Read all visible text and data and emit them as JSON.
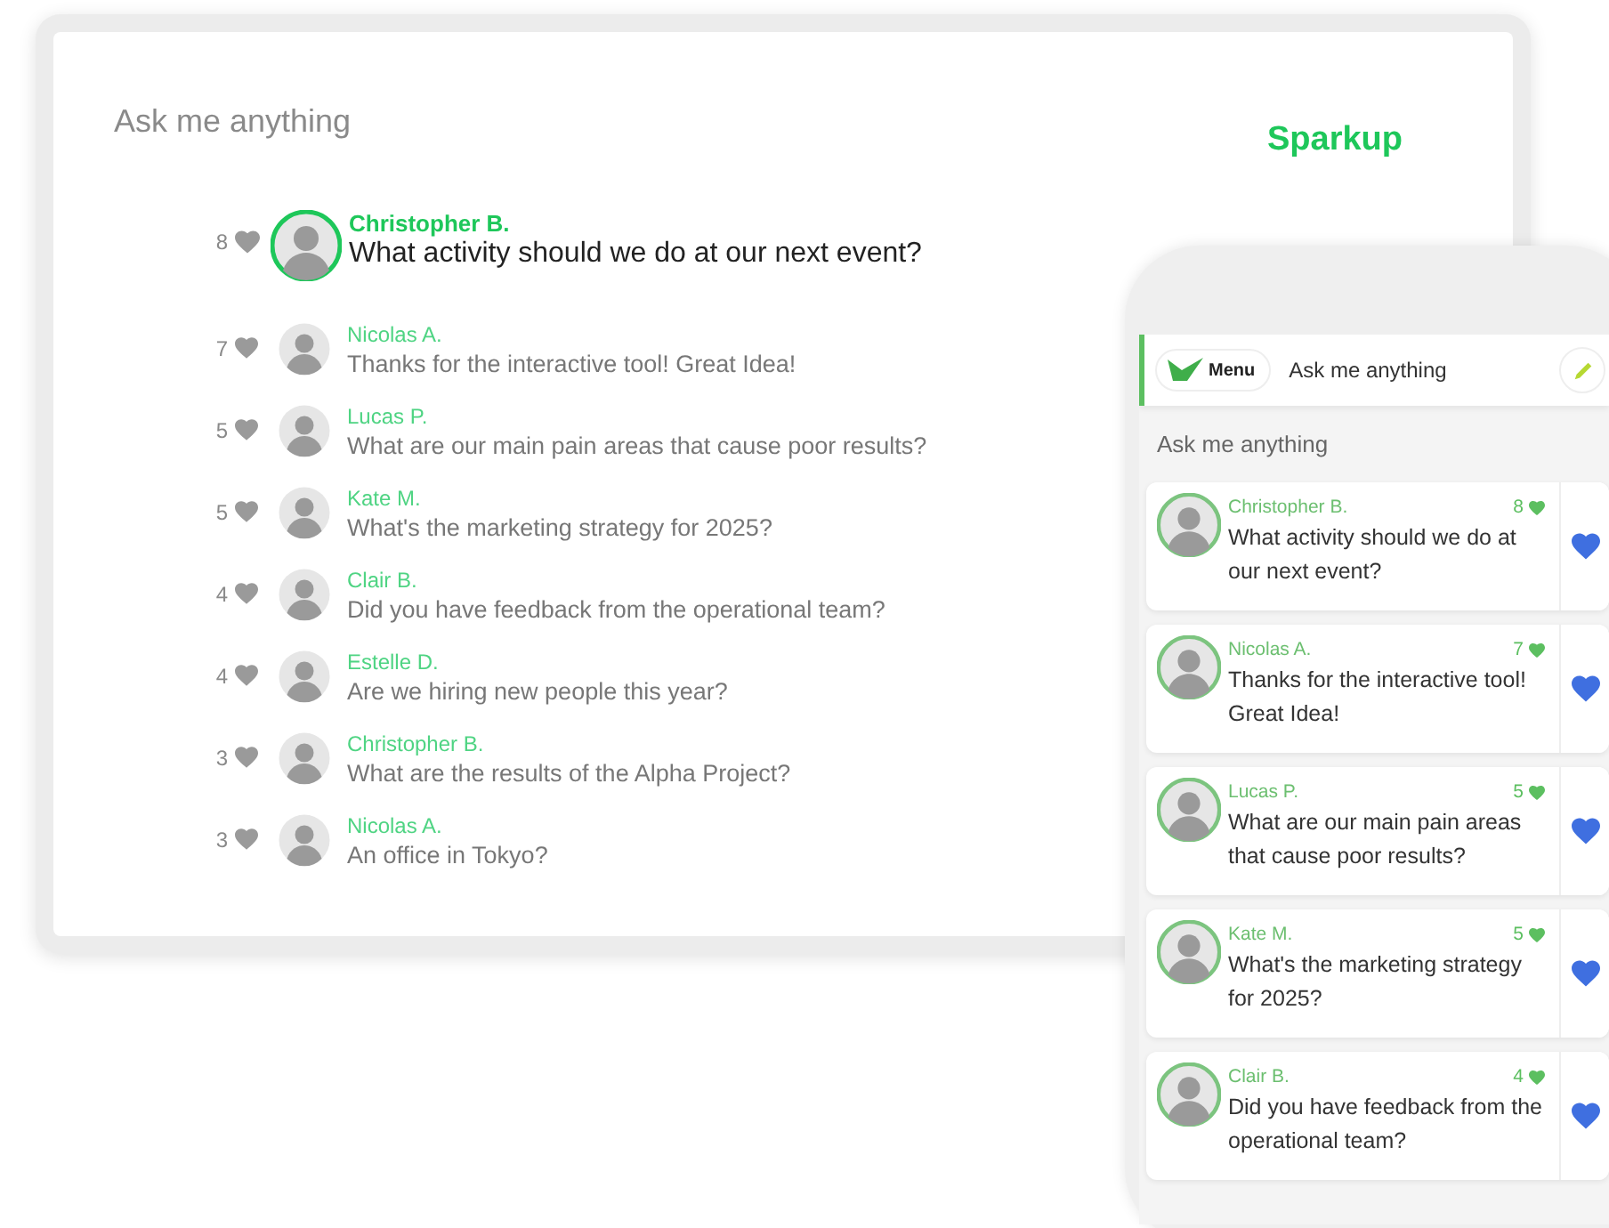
{
  "desktop": {
    "title": "Ask me anything",
    "logo": "Sparkup",
    "questions": [
      {
        "author": "Christopher B.",
        "question": "What activity should we do at our next event?",
        "votes": "8",
        "featured": true
      },
      {
        "author": "Nicolas A.",
        "question": "Thanks for the interactive tool! Great Idea!",
        "votes": "7",
        "featured": false
      },
      {
        "author": "Lucas P.",
        "question": "What are our main pain areas that cause poor results?",
        "votes": "5",
        "featured": false
      },
      {
        "author": "Kate M.",
        "question": "What's the marketing strategy for 2025?",
        "votes": "5",
        "featured": false
      },
      {
        "author": "Clair B.",
        "question": "Did you have feedback from the operational team?",
        "votes": "4",
        "featured": false
      },
      {
        "author": "Estelle D.",
        "question": "Are we hiring new people this year?",
        "votes": "4",
        "featured": false
      },
      {
        "author": "Christopher B.",
        "question": "What are the results of the Alpha Project?",
        "votes": "3",
        "featured": false
      },
      {
        "author": "Nicolas A.",
        "question": "An office in Tokyo?",
        "votes": "3",
        "featured": false
      }
    ]
  },
  "phone": {
    "menu_label": "Menu",
    "header_title": "Ask me anything",
    "section_title": "Ask me anything",
    "questions": [
      {
        "author": "Christopher B.",
        "votes": "8",
        "question": "What activity should we do at our next event?",
        "liked": true
      },
      {
        "author": "Nicolas A.",
        "votes": "7",
        "question": "Thanks for the interactive tool! Great Idea!",
        "liked": true
      },
      {
        "author": "Lucas P.",
        "votes": "5",
        "question": "What are our main pain areas that cause poor results?",
        "liked": true
      },
      {
        "author": "Kate M.",
        "votes": "5",
        "question": "What's the marketing strategy for 2025?",
        "liked": true
      },
      {
        "author": "Clair B.",
        "votes": "4",
        "question": "Did you have feedback from the operational team?",
        "liked": true
      }
    ]
  }
}
